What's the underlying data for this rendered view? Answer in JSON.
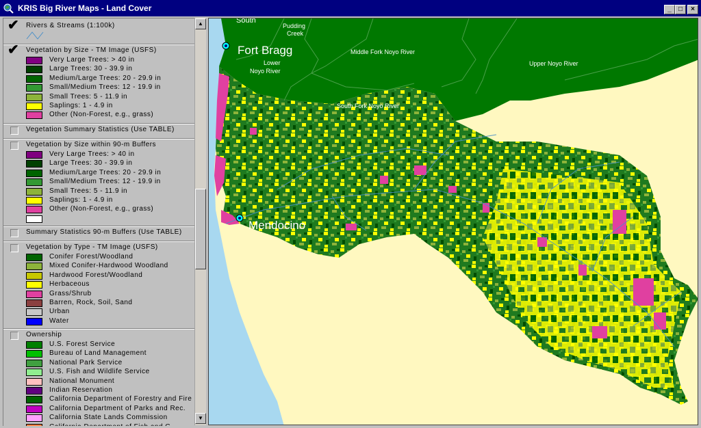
{
  "window": {
    "title": "KRIS Big River Maps - Land Cover",
    "buttons": [
      "_",
      "□",
      "×"
    ]
  },
  "legend": {
    "themes": [
      {
        "id": "rivers",
        "name": "Rivers & Streams (1:100k)",
        "checked": true,
        "items": []
      },
      {
        "id": "veg_size",
        "name": "Vegetation by Size - TM Image (USFS)",
        "checked": true,
        "items": [
          {
            "label": "Very Large Trees: > 40  in",
            "color": "#800080"
          },
          {
            "label": "Large Trees: 30 - 39.9 in",
            "color": "#004000"
          },
          {
            "label": "Medium/Large Trees: 20 - 29.9 in",
            "color": "#006400"
          },
          {
            "label": "Small/Medium Trees: 12 - 19.9 in",
            "color": "#339933"
          },
          {
            "label": "Small Trees: 5 - 11.9 in",
            "color": "#8db33a"
          },
          {
            "label": "Saplings: 1 - 4.9 in",
            "color": "#ffff00"
          },
          {
            "label": "Other (Non-Forest, e.g., grass)",
            "color": "#e040a0"
          }
        ]
      },
      {
        "id": "veg_summary",
        "name": "Vegetation Summary Statistics (Use TABLE)",
        "checked": false,
        "items": []
      },
      {
        "id": "veg_buffers",
        "name": "Vegetation by Size within 90-m Buffers",
        "checked": false,
        "items": [
          {
            "label": "Very Large Trees: > 40  in",
            "color": "#800080"
          },
          {
            "label": "Large Trees: 30 - 39.9 in",
            "color": "#004000"
          },
          {
            "label": "Medium/Large Trees: 20 - 29.9 in",
            "color": "#006400"
          },
          {
            "label": "Small/Medium Trees: 12 - 19.9 in",
            "color": "#339933"
          },
          {
            "label": "Small Trees: 5 - 11.9 in",
            "color": "#8db33a"
          },
          {
            "label": "Saplings: 1 - 4.9 in",
            "color": "#ffff00"
          },
          {
            "label": "Other (Non-Forest, e.g., grass)",
            "color": "#e040a0"
          },
          {
            "label": "",
            "color": "#ffffff"
          }
        ]
      },
      {
        "id": "summary_buffers",
        "name": "Summary Statistics 90-m Buffers (Use TABLE)",
        "checked": false,
        "items": []
      },
      {
        "id": "veg_type",
        "name": "Vegetation by Type - TM Image (USFS)",
        "checked": false,
        "items": [
          {
            "label": "Conifer Forest/Woodland",
            "color": "#006400"
          },
          {
            "label": "Mixed Conifer-Hardwood Woodland",
            "color": "#8db33a"
          },
          {
            "label": "Hardwood Forest/Woodland",
            "color": "#c8c800"
          },
          {
            "label": "Herbaceous",
            "color": "#ffff00"
          },
          {
            "label": "Grass/Shrub",
            "color": "#e040a0"
          },
          {
            "label": "Barren, Rock, Soil, Sand",
            "color": "#8b4040"
          },
          {
            "label": "Urban",
            "color": "#c8c8c8"
          },
          {
            "label": "Water",
            "color": "#0000ff"
          }
        ]
      },
      {
        "id": "ownership",
        "name": "Ownership",
        "checked": false,
        "items": [
          {
            "label": "U.S. Forest Service",
            "color": "#008000"
          },
          {
            "label": "Bureau of Land Management",
            "color": "#00c000"
          },
          {
            "label": "National Park Service",
            "color": "#40a040"
          },
          {
            "label": "U.S. Fish and Wildlife Service",
            "color": "#90ee90"
          },
          {
            "label": "National Monument",
            "color": "#ffc0c0"
          },
          {
            "label": "Indian Reservation",
            "color": "#600080"
          },
          {
            "label": "California Department of Forestry and Fire",
            "color": "#006400"
          },
          {
            "label": "California Department of Parks and Rec.",
            "color": "#c000c0"
          },
          {
            "label": "California State Lands Commission",
            "color": "#ffa0ff"
          },
          {
            "label": "California Department of Fish and G",
            "color": "#ff8040"
          }
        ]
      }
    ]
  },
  "map": {
    "labels": {
      "south": "South",
      "pudding_creek": "Pudding\nCreek",
      "fort_bragg": "Fort Bragg",
      "middle_fork": "Middle Fork Noyo River",
      "lower_noyo": "Lower\nNoyo River",
      "upper_noyo": "Upper Noyo River",
      "south_fork": "South Fork Noyo River",
      "mendocino": "Mendocino"
    },
    "colors": {
      "ocean": "#a8d8f0",
      "land": "#fff8c0",
      "noyo_basin": "#007800",
      "forest_dark": "#1a6b1a",
      "sapling": "#ffff00",
      "non_forest": "#e040a0",
      "streams": "#4a90c8",
      "town_marker": "#00ffff"
    }
  }
}
